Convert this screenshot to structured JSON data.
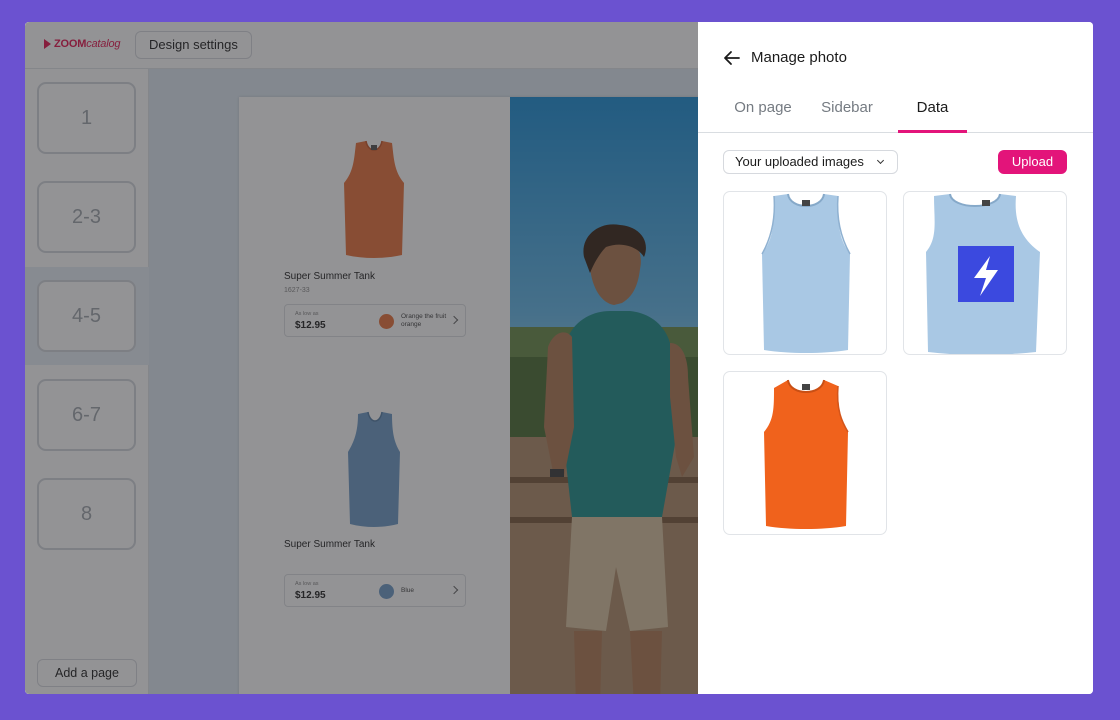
{
  "app": {
    "logo_bold": "ZOOM",
    "logo_light": "catalog",
    "design_settings_label": "Design settings"
  },
  "pages_sidebar": {
    "items": [
      {
        "label": "1",
        "active": false
      },
      {
        "label": "2-3",
        "active": false
      },
      {
        "label": "4-5",
        "active": true
      },
      {
        "label": "6-7",
        "active": false
      },
      {
        "label": "8",
        "active": false
      }
    ],
    "add_page_label": "Add a page"
  },
  "canvas": {
    "products": [
      {
        "name": "Super Summer Tank",
        "sku": "1627-33",
        "price_prefix": "As low as",
        "price": "$12.95",
        "color_label": "Orange the fruit orange",
        "color": "#E8733C"
      },
      {
        "name": "Super Summer Tank",
        "sku": "",
        "price_prefix": "As low as",
        "price": "$12.95",
        "color_label": "Blue",
        "color": "#6E9BC6"
      }
    ]
  },
  "panel": {
    "title": "Manage photo",
    "tabs": [
      {
        "label": "On page",
        "active": false
      },
      {
        "label": "Sidebar",
        "active": false
      },
      {
        "label": "Data",
        "active": true
      }
    ],
    "source_select": "Your uploaded images",
    "upload_label": "Upload",
    "accent_color": "#E3147A",
    "images": [
      {
        "kind": "tank-top",
        "color": "#A9C8E4"
      },
      {
        "kind": "tank-top-with-logo",
        "color": "#A9C8E4",
        "logo_color": "#3B49DF"
      },
      {
        "kind": "tank-top",
        "color": "#F0621C"
      }
    ]
  }
}
